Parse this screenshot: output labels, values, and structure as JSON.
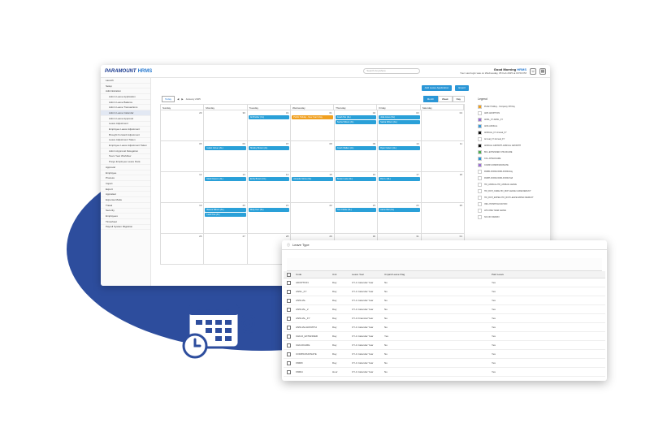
{
  "app": {
    "logo_brand": "PARAMOUNT",
    "logo_product": "HRMS",
    "search_placeholder": "Search Anywhere",
    "greeting": "Good Morning",
    "user": "HRMS",
    "last_login": "Your Last login was on Wednesday, 05 Feb 2025 at 03:53 PM"
  },
  "sidebar": {
    "items": [
      {
        "label": "Launch",
        "sub": false,
        "active": false
      },
      {
        "label": "Setup",
        "sub": false,
        "active": false
      },
      {
        "label": "Administration",
        "sub": false,
        "active": false
      },
      {
        "label": "Admin Leave Application",
        "sub": true,
        "active": false
      },
      {
        "label": "Admin Leave Balance",
        "sub": true,
        "active": false
      },
      {
        "label": "Admin Leave Transactions",
        "sub": true,
        "active": false
      },
      {
        "label": "Admin Leave Calendar",
        "sub": true,
        "active": true
      },
      {
        "label": "Admin Leave Approval",
        "sub": true,
        "active": false
      },
      {
        "label": "Leave Adjustment",
        "sub": true,
        "active": false
      },
      {
        "label": "Employee Leave Adjustment",
        "sub": true,
        "active": false
      },
      {
        "label": "Brought Forward Adjustment",
        "sub": true,
        "active": false
      },
      {
        "label": "Leave Adjustment Taken",
        "sub": true,
        "active": false
      },
      {
        "label": "Employee Leave Adjustment Taken",
        "sub": true,
        "active": false
      },
      {
        "label": "Admin Approval Delegation",
        "sub": true,
        "active": false
      },
      {
        "label": "Team Year Workflow",
        "sub": true,
        "active": false
      },
      {
        "label": "Purge Employee Leave Data",
        "sub": true,
        "active": false
      },
      {
        "label": "Approval",
        "sub": false,
        "active": false
      },
      {
        "label": "Employee",
        "sub": false,
        "active": false
      },
      {
        "label": "Process",
        "sub": false,
        "active": false
      },
      {
        "label": "Import",
        "sub": false,
        "active": false
      },
      {
        "label": "Export",
        "sub": false,
        "active": false
      },
      {
        "label": "Appraisal",
        "sub": false,
        "active": false
      },
      {
        "label": "Expense Mode",
        "sub": false,
        "active": false
      },
      {
        "label": "Travel",
        "sub": false,
        "active": false
      },
      {
        "label": "Security",
        "sub": false,
        "active": false
      },
      {
        "label": "Employees",
        "sub": false,
        "active": false
      },
      {
        "label": "Timesheet",
        "sub": false,
        "active": false
      },
      {
        "label": "Payroll System Migration",
        "sub": false,
        "active": false
      }
    ]
  },
  "calendar": {
    "btn_apply": "Add Leave Application",
    "btn_export": "Export",
    "today": "Today",
    "month": "January 2025",
    "views": [
      "Month",
      "Week",
      "Day"
    ],
    "active_view": "Month",
    "weekdays": [
      "Sunday",
      "Monday",
      "Tuesday",
      "Wednesday",
      "Thursday",
      "Friday",
      "Saturday"
    ],
    "weeks": [
      {
        "days": [
          "29",
          "30",
          "31",
          "01",
          "02",
          "03",
          "04"
        ]
      },
      {
        "days": [
          "05",
          "06",
          "07",
          "08",
          "09",
          "10",
          "11"
        ]
      },
      {
        "days": [
          "12",
          "13",
          "14",
          "15",
          "16",
          "17",
          "18"
        ]
      },
      {
        "days": [
          "19",
          "20",
          "21",
          "22",
          "23",
          "24",
          "25"
        ]
      },
      {
        "days": [
          "26",
          "27",
          "28",
          "29",
          "30",
          "31",
          "01"
        ]
      }
    ],
    "events": [
      {
        "week": 0,
        "day": 2,
        "row": 0,
        "label": "Ali Brother (CL)",
        "color": "blue"
      },
      {
        "week": 0,
        "day": 3,
        "row": 0,
        "label": "Public Holiday - New Year's Day",
        "color": "orange"
      },
      {
        "week": 0,
        "day": 4,
        "row": 0,
        "label": "Jonah Tan (AL)",
        "color": "blue"
      },
      {
        "week": 0,
        "day": 5,
        "row": 0,
        "label": "Julia Jones (SL)",
        "color": "blue"
      },
      {
        "week": 0,
        "day": 4,
        "row": 1,
        "label": "Sasha Wilson (AL)",
        "color": "blue"
      },
      {
        "week": 0,
        "day": 5,
        "row": 1,
        "label": "Sasha Wilson (AL)",
        "color": "blue"
      },
      {
        "week": 1,
        "day": 1,
        "row": 0,
        "label": "Isabel Glover (AL)",
        "color": "blue"
      },
      {
        "week": 1,
        "day": 2,
        "row": 0,
        "label": "Shelley Brown (AL)",
        "color": "blue"
      },
      {
        "week": 1,
        "day": 4,
        "row": 0,
        "label": "Jonah Walker (AL)",
        "color": "blue"
      },
      {
        "week": 1,
        "day": 5,
        "row": 0,
        "label": "Ryan Nelson (AL)",
        "color": "blue"
      },
      {
        "week": 2,
        "day": 1,
        "row": 0,
        "label": "Mark Deacon (AL)",
        "color": "blue"
      },
      {
        "week": 2,
        "day": 2,
        "row": 0,
        "label": "Emily Brown (CL)",
        "color": "blue"
      },
      {
        "week": 2,
        "day": 3,
        "row": 0,
        "label": "Amanda Stone (SL)",
        "color": "blue"
      },
      {
        "week": 2,
        "day": 4,
        "row": 0,
        "label": "Susan Lowe (AL)",
        "color": "blue"
      },
      {
        "week": 2,
        "day": 5,
        "row": 0,
        "label": "Ron Li (SL)",
        "color": "blue"
      },
      {
        "week": 3,
        "day": 1,
        "row": 0,
        "label": "Bianca Wilson (AL)",
        "color": "blue"
      },
      {
        "week": 3,
        "day": 2,
        "row": 0,
        "label": "Ruby Kerr (SL)",
        "color": "blue"
      },
      {
        "week": 3,
        "day": 4,
        "row": 0,
        "label": "Tom Clarke (AL)",
        "color": "blue"
      },
      {
        "week": 3,
        "day": 5,
        "row": 0,
        "label": "Aaron Bell (SL)",
        "color": "blue"
      },
      {
        "week": 3,
        "day": 1,
        "row": 1,
        "label": "Leah Kite (AL)",
        "color": "blue"
      }
    ]
  },
  "legend": {
    "title": "Legend",
    "items": [
      {
        "label": "Public Holiday - Company Off Day",
        "color": "#f0a020"
      },
      {
        "label": "ADP-ADOPTION",
        "color": "#ffffff"
      },
      {
        "label": "ANNL_FY-ANNL_FY",
        "color": "#9c6fd6"
      },
      {
        "label": "ANN-ANNUAL",
        "color": "#3a9ad9"
      },
      {
        "label": "ANNUAL_FY-Annual_FY",
        "color": "#111111"
      },
      {
        "label": "Annual_FY-Annual_FY",
        "color": "#ffffff"
      },
      {
        "label": "ANNUAL GROWTH-ANNUAL GROWTH",
        "color": "#111111"
      },
      {
        "label": "BCL-EXTENDED CHILDCARE",
        "color": "#4caf50"
      },
      {
        "label": "CCL-CHILDCARE",
        "color": "#2a96d6"
      },
      {
        "label": "COMP-COMPASSIONATE",
        "color": "#9c6fd6"
      },
      {
        "label": "FMRD-FFRD-FFRD-FFRD-Day",
        "color": "#ffffff"
      },
      {
        "label": "FMRH-FFRD-FFRD-FFRD-Half",
        "color": "#ffffff"
      },
      {
        "label": "HO_ANNUAL-HO_ANNUAL LEAVE",
        "color": "#ffffff"
      },
      {
        "label": "HO_RCH_CARE-HO_RCH LEAVE CARE DEDUCT",
        "color": "#ffffff"
      },
      {
        "label": "HO_RCH_EXPEC-HO_RCH LEAVE EXPEC DEDUCT",
        "color": "#ffffff"
      },
      {
        "label": "INFL-HOSPITALISATION",
        "color": "#ffffff"
      },
      {
        "label": "LPF-ONE YEAR LEAVE",
        "color": "#ffffff"
      },
      {
        "label": "NO-NO DRAWN",
        "color": "#ffffff"
      }
    ]
  },
  "leave_type": {
    "title": "Leave Type",
    "columns": [
      "Code",
      "Unit",
      "Leave Year",
      "Unpaid Leave Flag",
      "Paid Leave"
    ],
    "rows": [
      [
        "ADOPTION",
        "Day",
        "CY-1 Calendar Year",
        "No",
        "Yes"
      ],
      [
        "ANNL_FY",
        "Day",
        "CY-1 Calendar Year",
        "No",
        "Yes"
      ],
      [
        "ANNUAL",
        "Day",
        "CY-1 Calendar Year",
        "No",
        "Yes"
      ],
      [
        "ANNUAL_2",
        "Day",
        "CY-1 Calendar Year",
        "No",
        "Yes"
      ],
      [
        "ANNUAL_FY",
        "Day",
        "CY-1 Financial Year",
        "No",
        "Yes"
      ],
      [
        "ANNUALGROWTH",
        "Day",
        "CY-1 Calendar Year",
        "No",
        "Yes"
      ],
      [
        "CHILD_EXTENDED",
        "Day",
        "CY-1 Calendar Year",
        "Yes",
        "Yes"
      ],
      [
        "CHILDCARE",
        "Day",
        "CY-1 Calendar Year",
        "No",
        "Yes"
      ],
      [
        "COMPASSIONATE",
        "Day",
        "CY-1 Calendar Year",
        "No",
        "Yes"
      ],
      [
        "FMRD",
        "Day",
        "CY-1 Calendar Year",
        "No",
        "Yes"
      ],
      [
        "FMRH",
        "Hour",
        "CY-1 Calendar Year",
        "No",
        "Yes"
      ]
    ]
  }
}
